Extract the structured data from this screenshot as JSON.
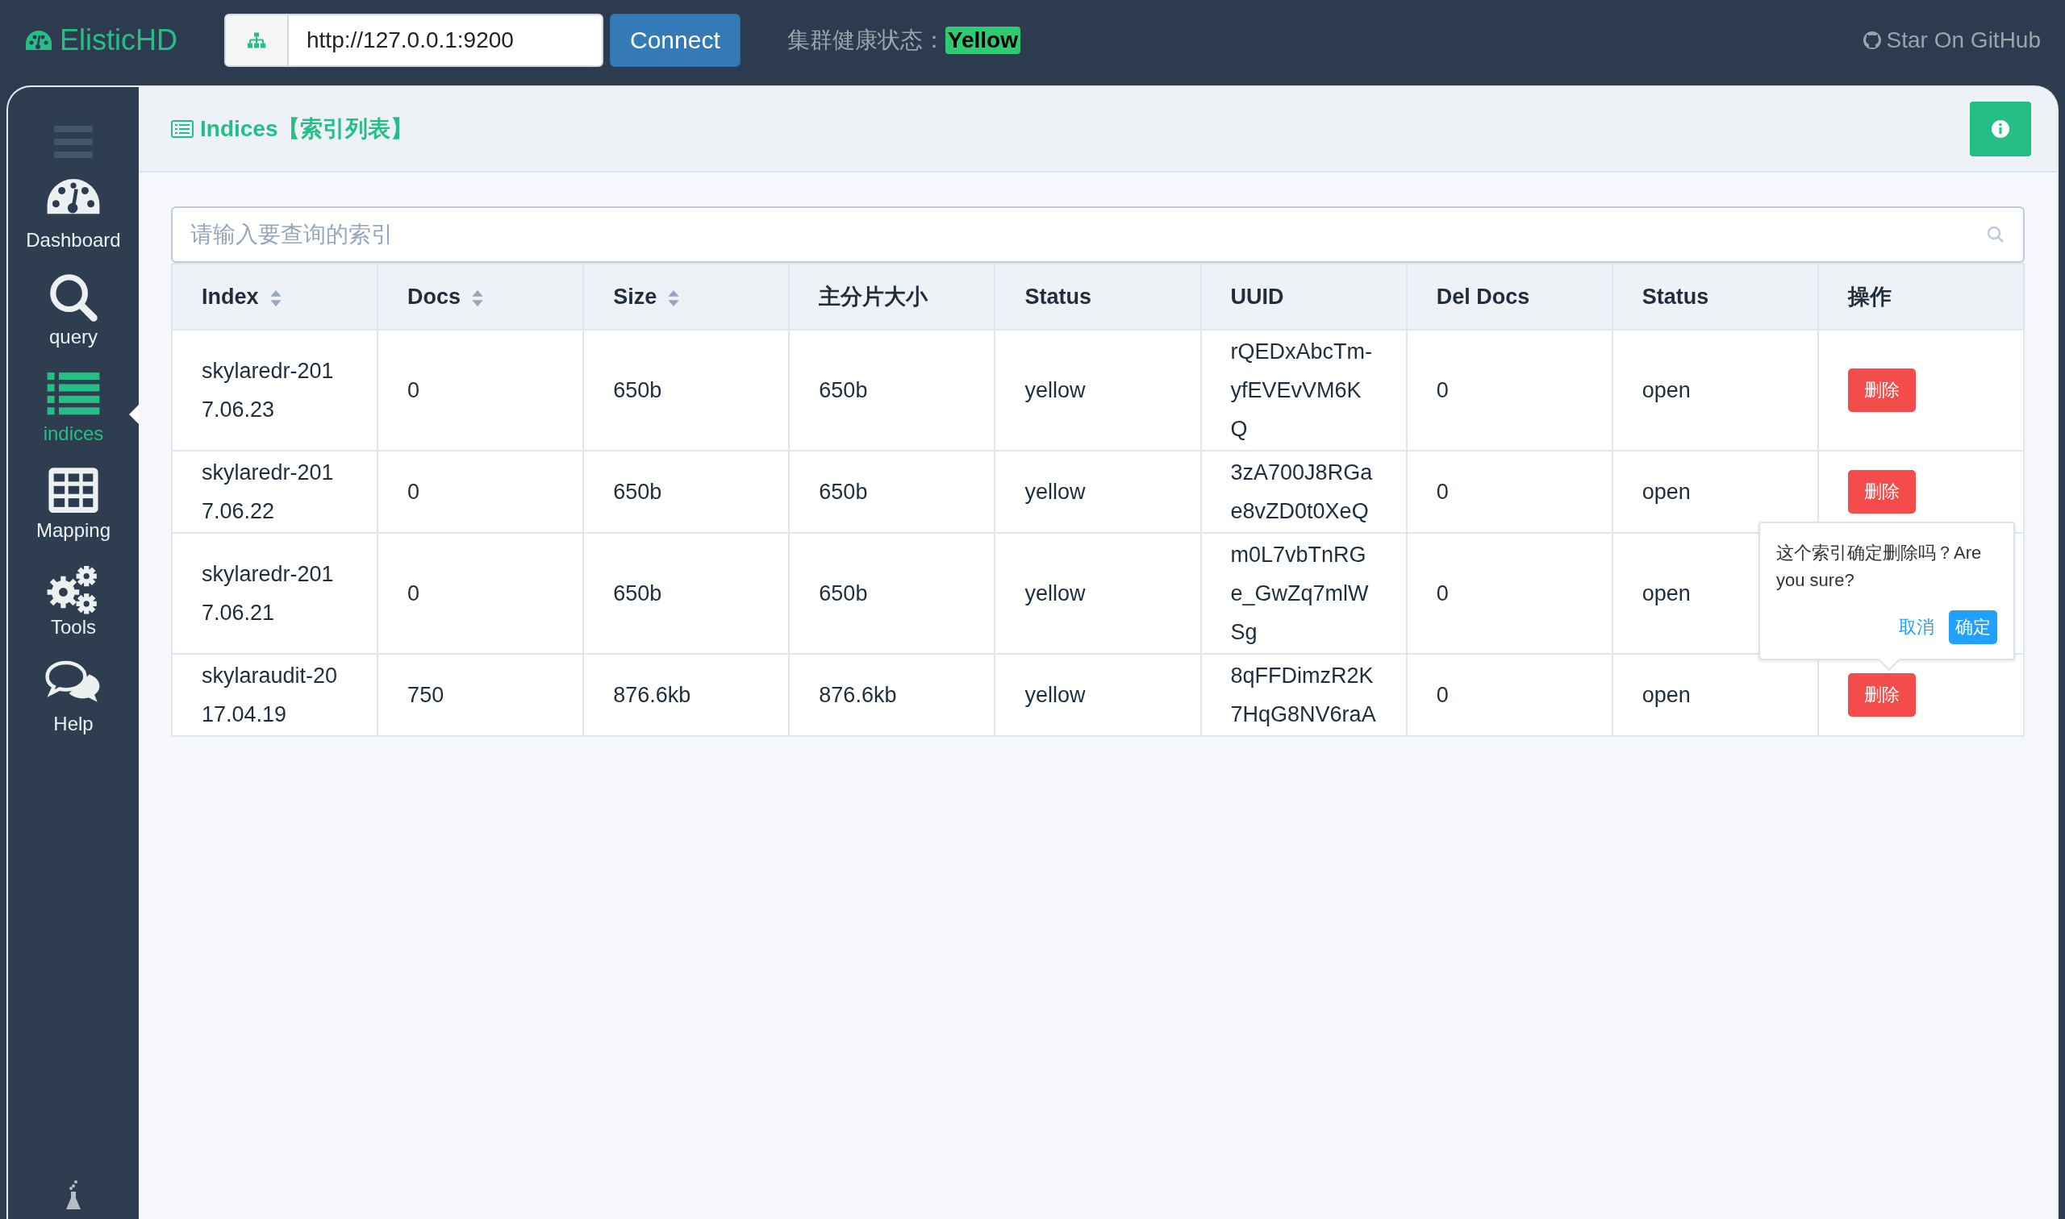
{
  "topbar": {
    "brand": "ElisticHD",
    "url": "http://127.0.0.1:9200",
    "connect": "Connect",
    "health_label": "集群健康状态：",
    "health": "Yellow",
    "github": "Star On GitHub"
  },
  "sidebar": {
    "items": [
      {
        "kind": "dashboard",
        "label": "Dashboard",
        "selected": false
      },
      {
        "kind": "query",
        "label": "query",
        "selected": false
      },
      {
        "kind": "indices",
        "label": "indices",
        "selected": true
      },
      {
        "kind": "mapping",
        "label": "Mapping",
        "selected": false
      },
      {
        "kind": "tools",
        "label": "Tools",
        "selected": false
      },
      {
        "kind": "help",
        "label": "Help",
        "selected": false
      }
    ]
  },
  "panel": {
    "title": "Indices【索引列表】",
    "search": {
      "placeholder": "请输入要查询的索引"
    },
    "table": {
      "columns": [
        {
          "label": "Index",
          "sortable": true
        },
        {
          "label": "Docs",
          "sortable": true
        },
        {
          "label": "Size",
          "sortable": true
        },
        {
          "label": "主分片大小",
          "sortable": false
        },
        {
          "label": "Status",
          "sortable": false
        },
        {
          "label": "UUID",
          "sortable": false
        },
        {
          "label": "Del Docs",
          "sortable": false
        },
        {
          "label": "Status",
          "sortable": false
        },
        {
          "label": "操作",
          "sortable": false
        }
      ],
      "rows": [
        {
          "cells": [
            "skylaredr-2017.06.23",
            "0",
            "650b",
            "650b",
            "yellow",
            "rQEDxAbcTm-yfEVEvVM6KQ",
            "0",
            "open"
          ],
          "action": "删除"
        },
        {
          "cells": [
            "skylaredr-2017.06.22",
            "0",
            "650b",
            "650b",
            "yellow",
            "3zA700J8RGae8vZD0t0XeQ",
            "0",
            "open"
          ],
          "action": "删除"
        },
        {
          "cells": [
            "skylaredr-2017.06.21",
            "0",
            "650b",
            "650b",
            "yellow",
            "m0L7vbTnRGe_GwZq7mlWSg",
            "0",
            "open"
          ]
        },
        {
          "cells": [
            "skylaraudit-2017.04.19",
            "750",
            "876.6kb",
            "876.6kb",
            "yellow",
            "8qFFDimzR2K7HqG8NV6raA",
            "0",
            "open"
          ],
          "action": "删除"
        }
      ]
    },
    "popover": {
      "message": "这个索引确定删除吗？Are you sure?",
      "cancel": "取消",
      "confirm": "确定"
    }
  }
}
